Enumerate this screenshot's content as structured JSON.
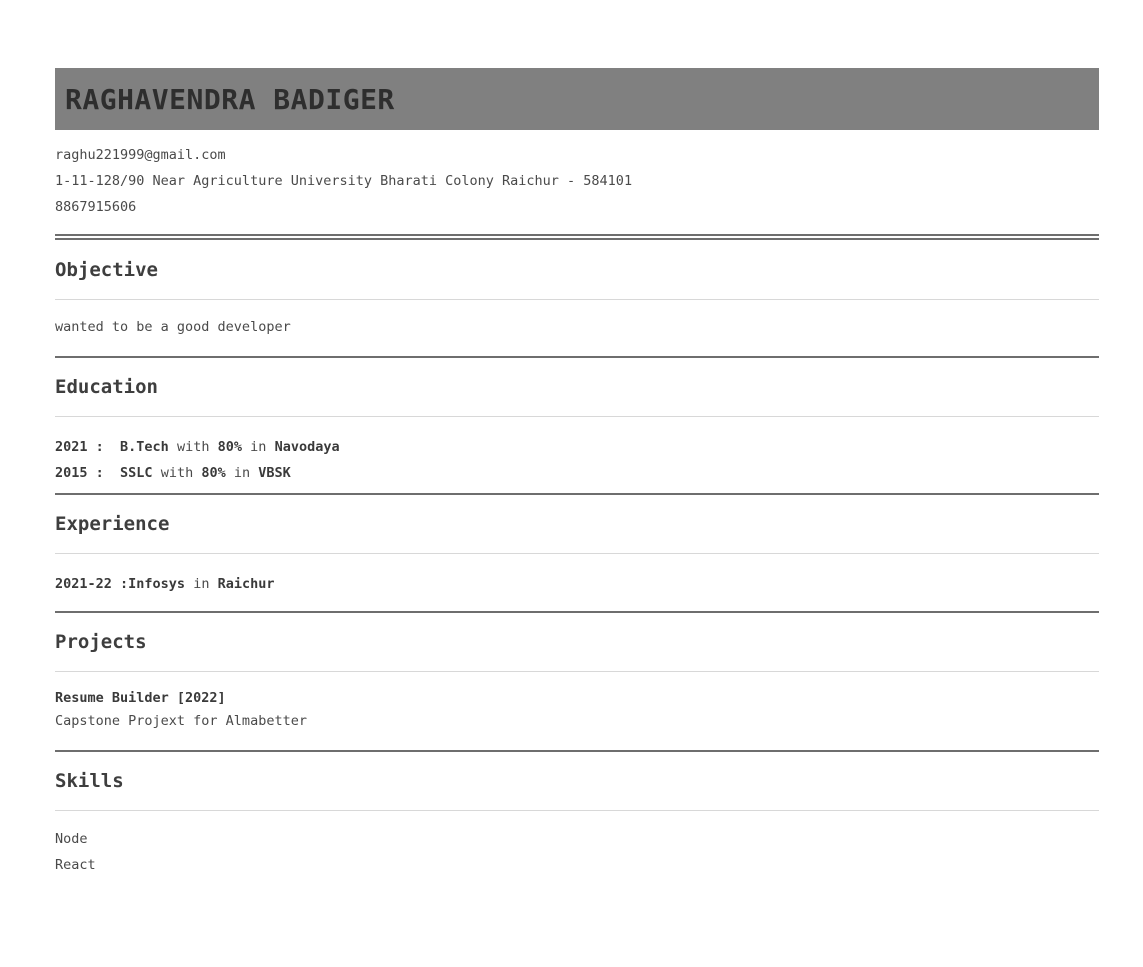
{
  "header": {
    "name": "RAGHAVENDRA BADIGER",
    "email": "raghu221999@gmail.com",
    "address": "1-11-128/90 Near Agriculture University Bharati Colony Raichur - 584101",
    "phone": "8867915606"
  },
  "objective": {
    "title": "Objective",
    "text": "wanted to be a good developer"
  },
  "education": {
    "title": "Education",
    "entries": [
      {
        "year": "2021 :",
        "degree": "B.Tech",
        "with": "with",
        "score": "80%",
        "in": "in",
        "school": "Navodaya"
      },
      {
        "year": "2015 :",
        "degree": "SSLC",
        "with": "with",
        "score": "80%",
        "in": "in",
        "school": "VBSK"
      }
    ]
  },
  "experience": {
    "title": "Experience",
    "entries": [
      {
        "period": "2021-22 :",
        "company": "Infosys",
        "in": "in",
        "location": "Raichur"
      }
    ]
  },
  "projects": {
    "title": "Projects",
    "entries": [
      {
        "name": "Resume Builder [2022]",
        "description": "Capstone Projext for Almabetter"
      }
    ]
  },
  "skills": {
    "title": "Skills",
    "items": [
      "Node",
      "React"
    ]
  }
}
